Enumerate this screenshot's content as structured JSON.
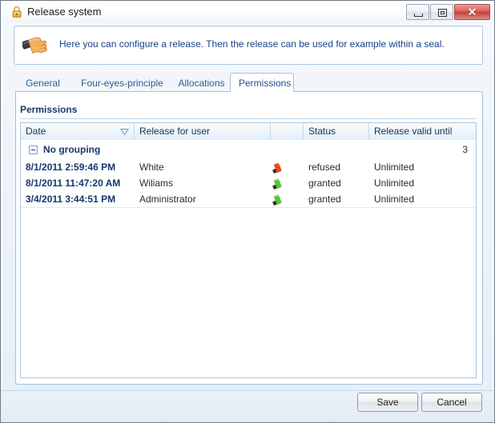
{
  "window": {
    "title": "Release system",
    "icon": "lock-icon",
    "controls": {
      "minimize": "minimize-button",
      "maximize": "maximize-button",
      "close": "close-button",
      "close_glyph": "✕"
    }
  },
  "banner": {
    "icon": "hand-icon",
    "text": "Here you can configure a release. Then the release can be used for example within a seal."
  },
  "tabs": [
    {
      "label": "General",
      "active": false
    },
    {
      "label": "Four-eyes-principle",
      "active": false
    },
    {
      "label": "Allocations",
      "active": false
    },
    {
      "label": "Permissions",
      "active": true
    }
  ],
  "section": {
    "title": "Permissions"
  },
  "grid": {
    "columns": [
      {
        "label": "Date",
        "sort": "descending"
      },
      {
        "label": "Release for user"
      },
      {
        "label": ""
      },
      {
        "label": "Status"
      },
      {
        "label": "Release valid until"
      }
    ],
    "group": {
      "label": "No grouping",
      "count": "3",
      "expanded": true,
      "expander_glyph": "−"
    },
    "rows": [
      {
        "date": "8/1/2011 2:59:46 PM",
        "user": "White",
        "status_icon": "hand-refused-icon",
        "status": "refused",
        "valid_until": "Unlimited"
      },
      {
        "date": "8/1/2011 11:47:20 AM",
        "user": "Wiliams",
        "status_icon": "hand-granted-icon",
        "status": "granted",
        "valid_until": "Unlimited"
      },
      {
        "date": "3/4/2011 3:44:51 PM",
        "user": "Administrator",
        "status_icon": "hand-granted-icon",
        "status": "granted",
        "valid_until": "Unlimited"
      }
    ]
  },
  "footer": {
    "save_label": "Save",
    "cancel_label": "Cancel"
  },
  "colors": {
    "accent_blue": "#15386d",
    "border_blue": "#a8c6e0",
    "banner_text": "#16418a",
    "refused_red": "#e8491c",
    "granted_green": "#5ec234",
    "close_red": "#c5403a",
    "lock_gold": "#e8b73a"
  }
}
